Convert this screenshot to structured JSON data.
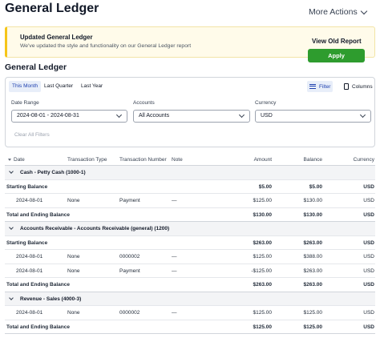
{
  "header": {
    "title": "General Ledger",
    "more_actions": "More Actions"
  },
  "banner": {
    "title": "Updated General Ledger",
    "text": "We've updated the style and functionality on our General Ledger report",
    "button": "View Old Report"
  },
  "section_title": "General Ledger",
  "filters": {
    "tabs": [
      "This Month",
      "Last Quarter",
      "Last Year"
    ],
    "filter_label": "Filter",
    "columns_label": "Columns",
    "date_range_label": "Date Range",
    "date_range_value": "2024-08-01 - 2024-08-31",
    "accounts_label": "Accounts",
    "accounts_value": "All Accounts",
    "currency_label": "Currency",
    "currency_value": "USD",
    "apply": "Apply",
    "clear": "Clear All Filters"
  },
  "table": {
    "columns": [
      "Date",
      "Transaction Type",
      "Transaction Number",
      "Note",
      "Amount",
      "Balance",
      "Currency"
    ],
    "rows": [
      {
        "kind": "group",
        "label": "Cash - Petty Cash (1000-1)"
      },
      {
        "kind": "start",
        "label": "Starting Balance",
        "amount": "$5.00",
        "balance": "$5.00",
        "currency": "USD"
      },
      {
        "kind": "txn",
        "date": "2024-08-01",
        "type": "None",
        "number": "Payment",
        "note": "—",
        "amount": "$125.00",
        "balance": "$130.00",
        "currency": "USD"
      },
      {
        "kind": "total",
        "label": "Total and Ending Balance",
        "amount": "$130.00",
        "balance": "$130.00",
        "currency": "USD"
      },
      {
        "kind": "group",
        "label": "Accounts Receivable - Accounts Receivable (general) (1200)"
      },
      {
        "kind": "start",
        "label": "Starting Balance",
        "amount": "$263.00",
        "balance": "$263.00",
        "currency": "USD"
      },
      {
        "kind": "txn",
        "date": "2024-08-01",
        "type": "None",
        "number": "0000002",
        "note": "—",
        "amount": "$125.00",
        "balance": "$388.00",
        "currency": "USD"
      },
      {
        "kind": "txn",
        "date": "2024-08-01",
        "type": "None",
        "number": "Payment",
        "note": "—",
        "amount": "-$125.00",
        "balance": "$263.00",
        "currency": "USD"
      },
      {
        "kind": "total",
        "label": "Total and Ending Balance",
        "amount": "$263.00",
        "balance": "$263.00",
        "currency": "USD"
      },
      {
        "kind": "group",
        "label": "Revenue - Sales (4000-3)"
      },
      {
        "kind": "txn",
        "date": "2024-08-01",
        "type": "None",
        "number": "0000002",
        "note": "—",
        "amount": "$125.00",
        "balance": "$125.00",
        "currency": "USD"
      },
      {
        "kind": "total",
        "label": "Total and Ending Balance",
        "amount": "$125.00",
        "balance": "$125.00",
        "currency": "USD"
      }
    ]
  }
}
